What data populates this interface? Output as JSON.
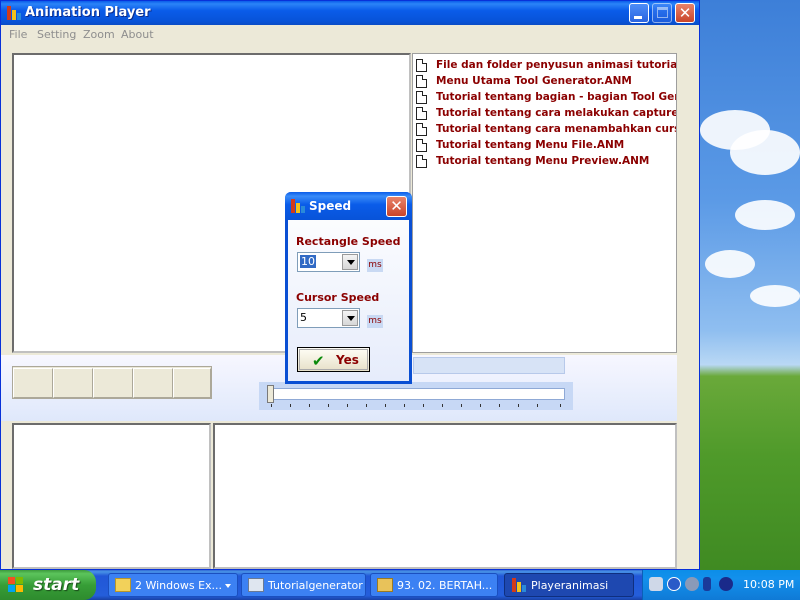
{
  "window": {
    "title": "Animation Player"
  },
  "menu": {
    "items": [
      "File",
      "Setting",
      "Zoom",
      "About"
    ]
  },
  "file_list": {
    "items": [
      "File dan folder penyusun animasi tutorial.ANM",
      "Menu Utama Tool Generator.ANM",
      "Tutorial tentang bagian - bagian Tool Generator.ANM",
      "Tutorial tentang cara melakukan capture layar.ANM",
      "Tutorial tentang cara menambahkan cursor pada animasi.ANM",
      "Tutorial tentang Menu File.ANM",
      "Tutorial tentang Menu Preview.ANM"
    ]
  },
  "dialog": {
    "title": "Speed",
    "rect_label": "Rectangle Speed",
    "rect_value": "10",
    "rect_unit": "ms",
    "cursor_label": "Cursor Speed",
    "cursor_value": "5",
    "cursor_unit": "ms",
    "yes_label": "Yes"
  },
  "taskbar": {
    "start_label": "start",
    "tasks": [
      "2 Windows Ex...",
      "Tutorialgenerator",
      "93. 02. BERTAH...",
      "Playeranimasi"
    ],
    "clock": "10:08 PM"
  },
  "colors": {
    "xp_blue": "#0a5ce9",
    "list_text": "#8b0000",
    "start_green": "#379e37"
  },
  "icons": {
    "app": "app-bars-icon",
    "file": "document-icon",
    "close": "close-icon"
  }
}
